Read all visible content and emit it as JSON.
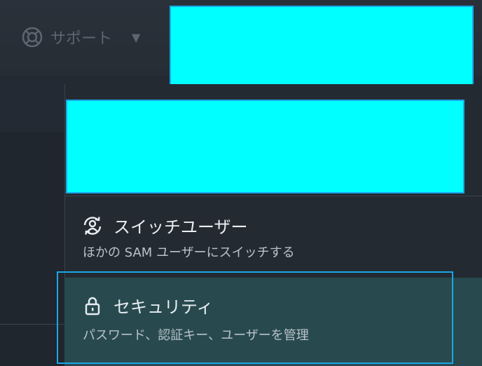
{
  "support": {
    "label": "サポート",
    "icon": "lifebuoy-icon",
    "caret": "▼"
  },
  "menu": {
    "items": [
      {
        "title": "スイッチユーザー",
        "description": "ほかの SAM ユーザーにスイッチする",
        "icon": "switch-user-icon"
      },
      {
        "title": "セキュリティ",
        "description": "パスワード、認証キー、ユーザーを管理",
        "icon": "lock-icon"
      }
    ]
  },
  "colors": {
    "redaction": "#00ffff",
    "focus": "#19a7e6",
    "selected_bg": "#284a4f"
  }
}
